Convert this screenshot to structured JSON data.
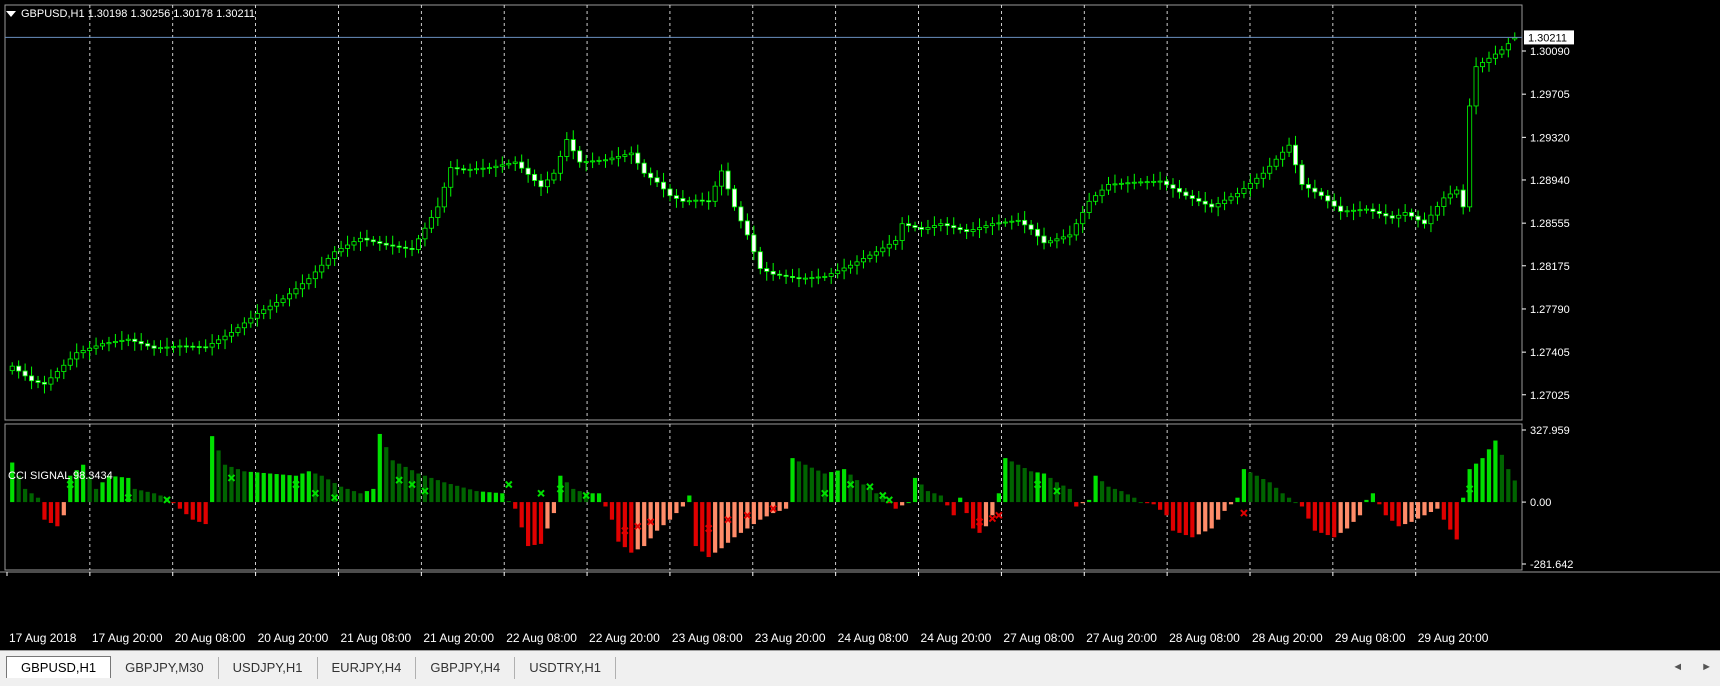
{
  "header": {
    "symbol_line": "GBPUSD,H1  1.30198 1.30256 1.30178 1.30211"
  },
  "indicator": {
    "label": "CCI SIGNAL 98.3434"
  },
  "colors": {
    "background": "#000000",
    "bull": "#00ff00",
    "bear_fill": "#ffffff",
    "strong_up": "#00e000",
    "weak_up": "#006400",
    "strong_down": "#e00000",
    "weak_down": "#ff8c69",
    "grid": "#ffffff",
    "price_line": "#6a8fbf"
  },
  "chart_data": [
    {
      "type": "candlestick",
      "name": "GBPUSD,H1",
      "ohlc_last": {
        "open": 1.30198,
        "high": 1.30256,
        "low": 1.30178,
        "close": 1.30211
      },
      "current_price_label": "1.30211",
      "y_ticks": [
        "1.30090",
        "1.29705",
        "1.29320",
        "1.28940",
        "1.28555",
        "1.28175",
        "1.27790",
        "1.27405",
        "1.27025"
      ],
      "ylim": [
        1.268,
        1.305
      ],
      "grid": "vertical dashed",
      "x_ticks": [
        "17 Aug 2018",
        "17 Aug 20:00",
        "20 Aug 08:00",
        "20 Aug 20:00",
        "21 Aug 08:00",
        "21 Aug 20:00",
        "22 Aug 08:00",
        "22 Aug 20:00",
        "23 Aug 08:00",
        "23 Aug 20:00",
        "24 Aug 08:00",
        "24 Aug 20:00",
        "27 Aug 08:00",
        "27 Aug 20:00",
        "28 Aug 08:00",
        "28 Aug 20:00",
        "29 Aug 08:00",
        "29 Aug 20:00"
      ],
      "close_anchors": [
        [
          0,
          1.2728
        ],
        [
          3,
          1.2715
        ],
        [
          5,
          1.2712
        ],
        [
          10,
          1.274
        ],
        [
          14,
          1.2748
        ],
        [
          18,
          1.2752
        ],
        [
          22,
          1.2744
        ],
        [
          26,
          1.2746
        ],
        [
          30,
          1.2745
        ],
        [
          34,
          1.2758
        ],
        [
          38,
          1.2775
        ],
        [
          42,
          1.2788
        ],
        [
          46,
          1.2806
        ],
        [
          50,
          1.283
        ],
        [
          54,
          1.2842
        ],
        [
          58,
          1.2836
        ],
        [
          62,
          1.2832
        ],
        [
          66,
          1.287
        ],
        [
          68,
          1.2905
        ],
        [
          70,
          1.2903
        ],
        [
          74,
          1.2905
        ],
        [
          78,
          1.291
        ],
        [
          82,
          1.2888
        ],
        [
          84,
          1.29
        ],
        [
          86,
          1.293
        ],
        [
          88,
          1.291
        ],
        [
          92,
          1.2912
        ],
        [
          96,
          1.2918
        ],
        [
          98,
          1.29
        ],
        [
          100,
          1.2892
        ],
        [
          102,
          1.288
        ],
        [
          104,
          1.2875
        ],
        [
          106,
          1.2876
        ],
        [
          108,
          1.2875
        ],
        [
          110,
          1.2902
        ],
        [
          112,
          1.287
        ],
        [
          114,
          1.2845
        ],
        [
          116,
          1.2815
        ],
        [
          118,
          1.281
        ],
        [
          122,
          1.2806
        ],
        [
          126,
          1.2808
        ],
        [
          130,
          1.2818
        ],
        [
          134,
          1.283
        ],
        [
          137,
          1.284
        ],
        [
          138,
          1.2855
        ],
        [
          141,
          1.285
        ],
        [
          144,
          1.2855
        ],
        [
          148,
          1.2848
        ],
        [
          152,
          1.2855
        ],
        [
          156,
          1.2858
        ],
        [
          158,
          1.285
        ],
        [
          160,
          1.2838
        ],
        [
          164,
          1.2845
        ],
        [
          167,
          1.2875
        ],
        [
          170,
          1.289
        ],
        [
          174,
          1.2892
        ],
        [
          178,
          1.2893
        ],
        [
          182,
          1.288
        ],
        [
          186,
          1.287
        ],
        [
          190,
          1.2882
        ],
        [
          194,
          1.29
        ],
        [
          198,
          1.2925
        ],
        [
          200,
          1.289
        ],
        [
          203,
          1.288
        ],
        [
          206,
          1.2866
        ],
        [
          210,
          1.2868
        ],
        [
          214,
          1.286
        ],
        [
          216,
          1.2865
        ],
        [
          219,
          1.2855
        ],
        [
          222,
          1.2878
        ],
        [
          224,
          1.2885
        ],
        [
          225,
          1.287
        ],
        [
          226,
          1.296
        ],
        [
          227,
          1.2995
        ],
        [
          231,
          1.301
        ],
        [
          233,
          1.3021
        ]
      ],
      "candle_count": 234
    },
    {
      "type": "histogram",
      "name": "CCI SIGNAL",
      "value_last": 98.3434,
      "y_ticks": [
        "327.959",
        "0.00",
        "-281.642"
      ],
      "ylim": [
        -281.642,
        327.959
      ],
      "value_anchors": [
        [
          0,
          180
        ],
        [
          2,
          60
        ],
        [
          4,
          20
        ],
        [
          5,
          -80
        ],
        [
          7,
          -110
        ],
        [
          8,
          -60
        ],
        [
          9,
          120
        ],
        [
          11,
          170
        ],
        [
          13,
          60
        ],
        [
          15,
          120
        ],
        [
          18,
          110
        ],
        [
          19,
          60
        ],
        [
          22,
          40
        ],
        [
          24,
          20
        ],
        [
          26,
          -30
        ],
        [
          28,
          -80
        ],
        [
          30,
          -100
        ],
        [
          31,
          300
        ],
        [
          33,
          170
        ],
        [
          36,
          140
        ],
        [
          40,
          130
        ],
        [
          44,
          120
        ],
        [
          46,
          140
        ],
        [
          48,
          120
        ],
        [
          51,
          70
        ],
        [
          54,
          40
        ],
        [
          56,
          60
        ],
        [
          57,
          310
        ],
        [
          59,
          190
        ],
        [
          61,
          160
        ],
        [
          63,
          130
        ],
        [
          67,
          90
        ],
        [
          72,
          50
        ],
        [
          76,
          40
        ],
        [
          78,
          -30
        ],
        [
          80,
          -200
        ],
        [
          82,
          -190
        ],
        [
          84,
          -50
        ],
        [
          85,
          120
        ],
        [
          87,
          60
        ],
        [
          89,
          40
        ],
        [
          91,
          40
        ],
        [
          93,
          -80
        ],
        [
          94,
          -180
        ],
        [
          96,
          -230
        ],
        [
          98,
          -200
        ],
        [
          100,
          -130
        ],
        [
          102,
          -80
        ],
        [
          104,
          -20
        ],
        [
          105,
          30
        ],
        [
          106,
          -200
        ],
        [
          108,
          -250
        ],
        [
          110,
          -210
        ],
        [
          112,
          -160
        ],
        [
          114,
          -120
        ],
        [
          116,
          -80
        ],
        [
          118,
          -50
        ],
        [
          120,
          -30
        ],
        [
          121,
          200
        ],
        [
          123,
          170
        ],
        [
          126,
          130
        ],
        [
          129,
          150
        ],
        [
          131,
          100
        ],
        [
          133,
          60
        ],
        [
          135,
          20
        ],
        [
          137,
          -30
        ],
        [
          139,
          0
        ],
        [
          140,
          110
        ],
        [
          142,
          50
        ],
        [
          144,
          30
        ],
        [
          146,
          -60
        ],
        [
          147,
          20
        ],
        [
          149,
          -120
        ],
        [
          150,
          -140
        ],
        [
          151,
          -110
        ],
        [
          152,
          -60
        ],
        [
          153,
          40
        ],
        [
          154,
          200
        ],
        [
          156,
          170
        ],
        [
          158,
          140
        ],
        [
          160,
          130
        ],
        [
          162,
          90
        ],
        [
          164,
          60
        ],
        [
          165,
          -20
        ],
        [
          167,
          10
        ],
        [
          168,
          120
        ],
        [
          170,
          70
        ],
        [
          172,
          50
        ],
        [
          174,
          20
        ],
        [
          175,
          0
        ],
        [
          177,
          -10
        ],
        [
          179,
          -60
        ],
        [
          180,
          -130
        ],
        [
          183,
          -160
        ],
        [
          186,
          -120
        ],
        [
          188,
          -40
        ],
        [
          190,
          20
        ],
        [
          191,
          150
        ],
        [
          193,
          120
        ],
        [
          195,
          90
        ],
        [
          197,
          40
        ],
        [
          199,
          0
        ],
        [
          200,
          -20
        ],
        [
          202,
          -130
        ],
        [
          205,
          -160
        ],
        [
          207,
          -120
        ],
        [
          209,
          -60
        ],
        [
          210,
          10
        ],
        [
          211,
          40
        ],
        [
          213,
          -60
        ],
        [
          215,
          -110
        ],
        [
          217,
          -90
        ],
        [
          219,
          -60
        ],
        [
          221,
          -30
        ],
        [
          222,
          -80
        ],
        [
          224,
          -170
        ],
        [
          225,
          20
        ],
        [
          226,
          150
        ],
        [
          228,
          200
        ],
        [
          230,
          280
        ],
        [
          232,
          150
        ],
        [
          233,
          98.3434
        ]
      ],
      "cross_markers": [
        [
          9,
          80,
          "up"
        ],
        [
          18,
          20,
          "up"
        ],
        [
          24,
          10,
          "up"
        ],
        [
          34,
          110,
          "up"
        ],
        [
          44,
          80,
          "up"
        ],
        [
          47,
          40,
          "up"
        ],
        [
          50,
          20,
          "up"
        ],
        [
          60,
          100,
          "up"
        ],
        [
          62,
          80,
          "up"
        ],
        [
          64,
          50,
          "up"
        ],
        [
          77,
          80,
          "up"
        ],
        [
          82,
          40,
          "up"
        ],
        [
          85,
          60,
          "up"
        ],
        [
          89,
          30,
          "up"
        ],
        [
          95,
          -130,
          "down"
        ],
        [
          97,
          -110,
          "down"
        ],
        [
          99,
          -90,
          "down"
        ],
        [
          108,
          -120,
          "down"
        ],
        [
          111,
          -80,
          "down"
        ],
        [
          114,
          -60,
          "down"
        ],
        [
          118,
          -30,
          "down"
        ],
        [
          126,
          40,
          "up"
        ],
        [
          130,
          80,
          "up"
        ],
        [
          133,
          70,
          "up"
        ],
        [
          135,
          30,
          "up"
        ],
        [
          136,
          10,
          "up"
        ],
        [
          150,
          -90,
          "down"
        ],
        [
          152,
          -75,
          "down"
        ],
        [
          153,
          -60,
          "down"
        ],
        [
          159,
          80,
          "up"
        ],
        [
          162,
          50,
          "up"
        ],
        [
          191,
          -50,
          "down"
        ],
        [
          226,
          60,
          "up"
        ]
      ]
    }
  ],
  "tabs": [
    {
      "label": "GBPUSD,H1",
      "active": true
    },
    {
      "label": "GBPJPY,M30",
      "active": false
    },
    {
      "label": "USDJPY,H1",
      "active": false
    },
    {
      "label": "EURJPY,H4",
      "active": false
    },
    {
      "label": "GBPJPY,H4",
      "active": false
    },
    {
      "label": "USDTRY,H1",
      "active": false
    }
  ],
  "nav": {
    "left": "◄",
    "right": "►"
  }
}
